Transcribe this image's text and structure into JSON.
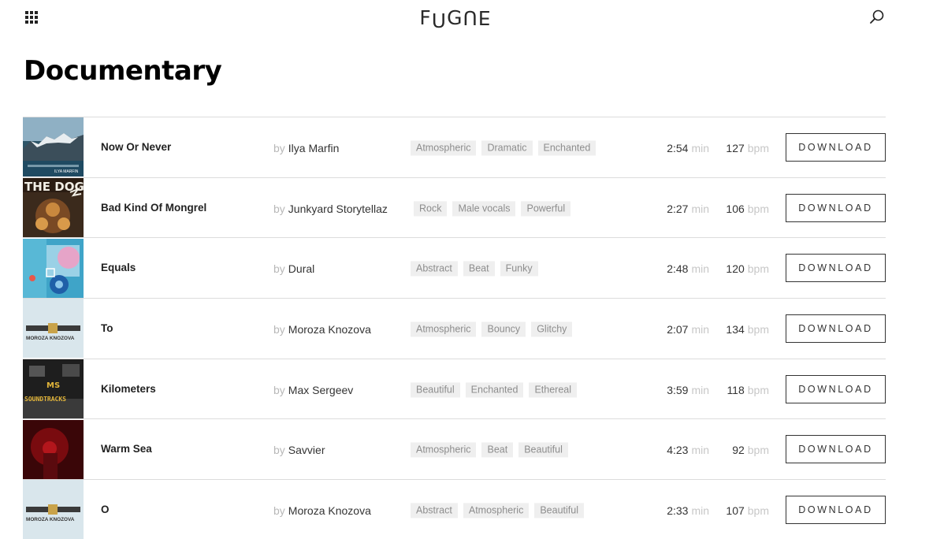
{
  "header": {
    "logo_text": "FUGUE",
    "logo_chars": [
      "F",
      "U",
      "G",
      "U",
      "E"
    ],
    "apps_icon": "apps-grid-icon",
    "search_icon": "search-icon"
  },
  "page": {
    "title": "Documentary"
  },
  "labels": {
    "by": "by",
    "min": "min",
    "bpm": "bpm",
    "download": "DOWNLOAD"
  },
  "tracks": [
    {
      "title": "Now Or Never",
      "artist": "Ilya Marfin",
      "tags": [
        "Atmospheric",
        "Dramatic",
        "Enchanted"
      ],
      "duration": "2:54",
      "bpm": "127",
      "cover_text": "ILYA MARFIN"
    },
    {
      "title": "Bad Kind Of Mongrel",
      "artist": "Junkyard Storytellaz",
      "tags": [
        "Rock",
        "Male vocals",
        "Powerful"
      ],
      "duration": "2:27",
      "bpm": "106",
      "cover_text": "THE DOG"
    },
    {
      "title": "Equals",
      "artist": "Dural",
      "tags": [
        "Abstract",
        "Beat",
        "Funky"
      ],
      "duration": "2:48",
      "bpm": "120",
      "cover_text": ""
    },
    {
      "title": "To",
      "artist": "Moroza Knozova",
      "tags": [
        "Atmospheric",
        "Bouncy",
        "Glitchy"
      ],
      "duration": "2:07",
      "bpm": "134",
      "cover_text": "MOROZA KNOZOVA"
    },
    {
      "title": "Kilometers",
      "artist": "Max Sergeev",
      "tags": [
        "Beautiful",
        "Enchanted",
        "Ethereal"
      ],
      "duration": "3:59",
      "bpm": "118",
      "cover_text": "SOUNDTRACKS"
    },
    {
      "title": "Warm Sea",
      "artist": "Savvier",
      "tags": [
        "Atmospheric",
        "Beat",
        "Beautiful"
      ],
      "duration": "4:23",
      "bpm": "92",
      "cover_text": ""
    },
    {
      "title": "O",
      "artist": "Moroza Knozova",
      "tags": [
        "Abstract",
        "Atmospheric",
        "Beautiful"
      ],
      "duration": "2:33",
      "bpm": "107",
      "cover_text": "MOROZA KNOZOVA"
    }
  ],
  "colors": {
    "text": "#222222",
    "muted": "#c7c7c7",
    "tag_bg": "#efefef",
    "tag_text": "#8d8d8d",
    "divider": "#dcdcdc"
  }
}
